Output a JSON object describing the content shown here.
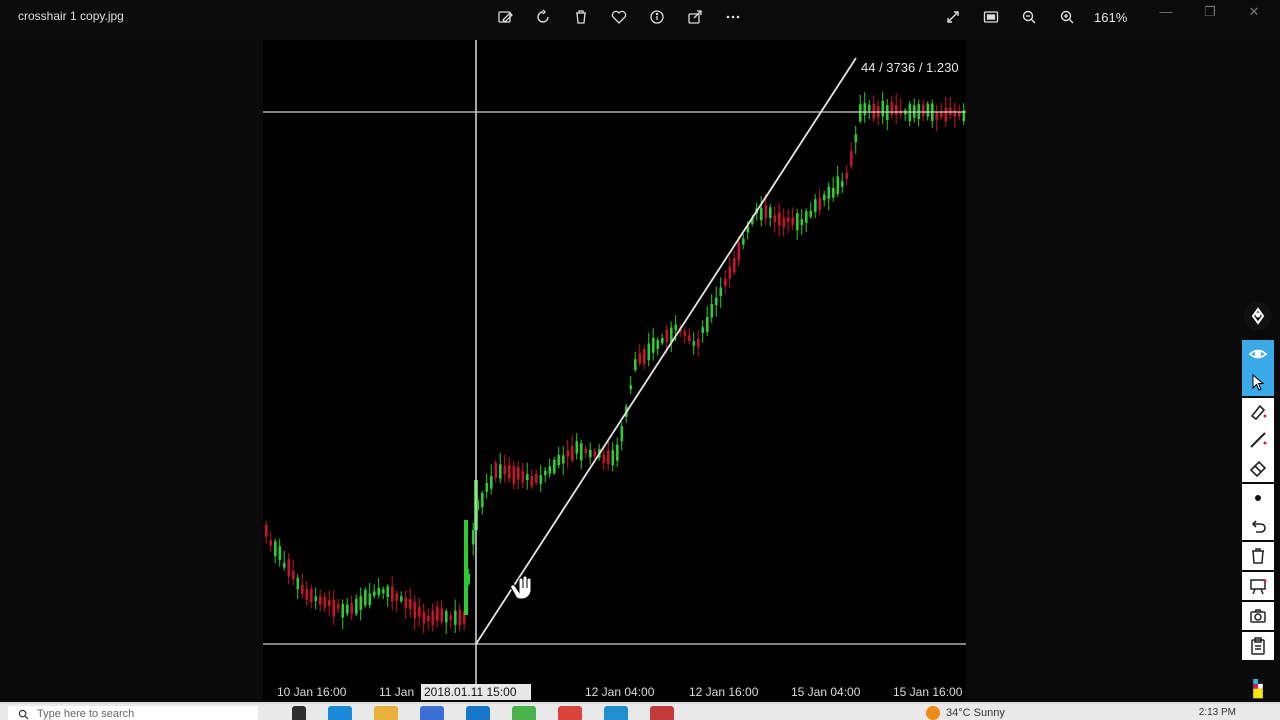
{
  "window": {
    "title": "crosshair 1 copy.jpg",
    "zoom": "161%"
  },
  "toolbar": {
    "icons": [
      "edit-image-icon",
      "rotate-icon",
      "delete-icon",
      "favorite-icon",
      "info-icon",
      "share-icon",
      "more-icon"
    ],
    "right_icons": [
      "fullscreen-icon",
      "fit-icon",
      "zoom-out-icon",
      "zoom-in-icon"
    ]
  },
  "chart": {
    "readout": "44 / 3736 / 1.230",
    "crosshair_datetime": "2018.01.11 15:00",
    "colors": {
      "bull": "#2ecc2e",
      "bear": "#c8142a",
      "grid": "#cfcfcf",
      "trendline": "#e6e6e6",
      "background": "#000000"
    }
  },
  "chart_data": {
    "type": "candlestick",
    "x_ticks": [
      "10 Jan 16:00",
      "11 Jan",
      "12 Jan 04:00",
      "12 Jan 16:00",
      "15 Jan 04:00",
      "15 Jan 16:00"
    ]
  },
  "taskbar": {
    "search_placeholder": "Type here to search",
    "weather": "34°C  Sunny",
    "time": "2:13 PM"
  },
  "sidebar": {
    "tools": [
      "pen-icon",
      "eye-icon",
      "cursor-icon",
      "highlighter-icon",
      "line-icon",
      "eraser-icon",
      "dot-icon",
      "undo-icon",
      "trash-icon",
      "whiteboard-icon",
      "camera-icon",
      "clipboard-icon",
      "color-palette-icon"
    ]
  }
}
